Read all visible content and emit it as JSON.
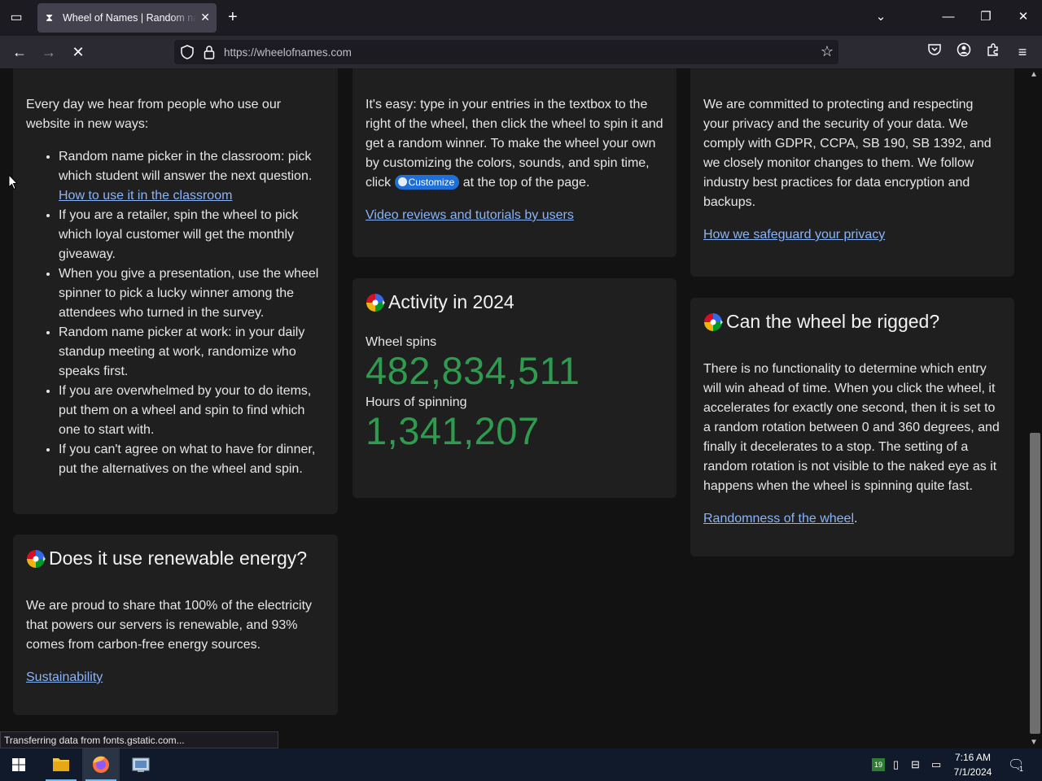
{
  "browser": {
    "tab_title": "Wheel of Names | Random name picker",
    "url": "https://wheelofnames.com",
    "status": "Transferring data from fonts.gstatic.com..."
  },
  "cards": {
    "what": {
      "intro": "Every day we hear from people who use our website in new ways:",
      "items": [
        "Random name picker in the classroom: pick which student will answer the next question.",
        "If you are a retailer, spin the wheel to pick which loyal customer will get the monthly giveaway.",
        "When you give a presentation, use the wheel spinner to pick a lucky winner among the attendees who turned in the survey.",
        "Random name picker at work: in your daily standup meeting at work, randomize who speaks first.",
        "If you are overwhelmed by your to do items, put them on a wheel and spin to find which one to start with.",
        "If you can't agree on what to have for dinner, put the alternatives on the wheel and spin."
      ],
      "classroom_link": "How to use it in the classroom"
    },
    "how": {
      "text_before": "It's easy: type in your entries in the textbox to the right of the wheel, then click the wheel to spin it and get a random winner. To make the wheel your own by customizing the colors, sounds, and spin time, click",
      "chip": "Customize",
      "text_after": "at the top of the page.",
      "link": "Video reviews and tutorials by users"
    },
    "privacy": {
      "text": "We are committed to protecting and respecting your privacy and the security of your data. We comply with GDPR, CCPA, SB 190, SB 1392, and we closely monitor changes to them. We follow industry best practices for data encryption and backups.",
      "link": "How we safeguard your privacy"
    },
    "activity": {
      "title": "Activity in 2024",
      "spins_label": "Wheel spins",
      "spins_value": "482,834,511",
      "hours_label": "Hours of spinning",
      "hours_value": "1,341,207"
    },
    "rigged": {
      "title": "Can the wheel be rigged?",
      "text": "There is no functionality to determine which entry will win ahead of time. When you click the wheel, it accelerates for exactly one second, then it is set to a random rotation between 0 and 360 degrees, and finally it decelerates to a stop. The setting of a random rotation is not visible to the naked eye as it happens when the wheel is spinning quite fast.",
      "link": "Randomness of the wheel",
      "period": "."
    },
    "energy": {
      "title": "Does it use renewable energy?",
      "text": "We are proud to share that 100% of the electricity that powers our servers is renewable, and 93% comes from carbon-free energy sources.",
      "link": "Sustainability"
    }
  },
  "taskbar": {
    "time": "7:16 AM",
    "date": "7/1/2024",
    "calendar_badge": "19",
    "notification_count": "1"
  },
  "colors": {
    "stat_green": "#2e9b4f",
    "link_blue": "#8ab4f8",
    "card_bg": "#1f1f1f",
    "chip_blue": "#1f6fd6"
  }
}
